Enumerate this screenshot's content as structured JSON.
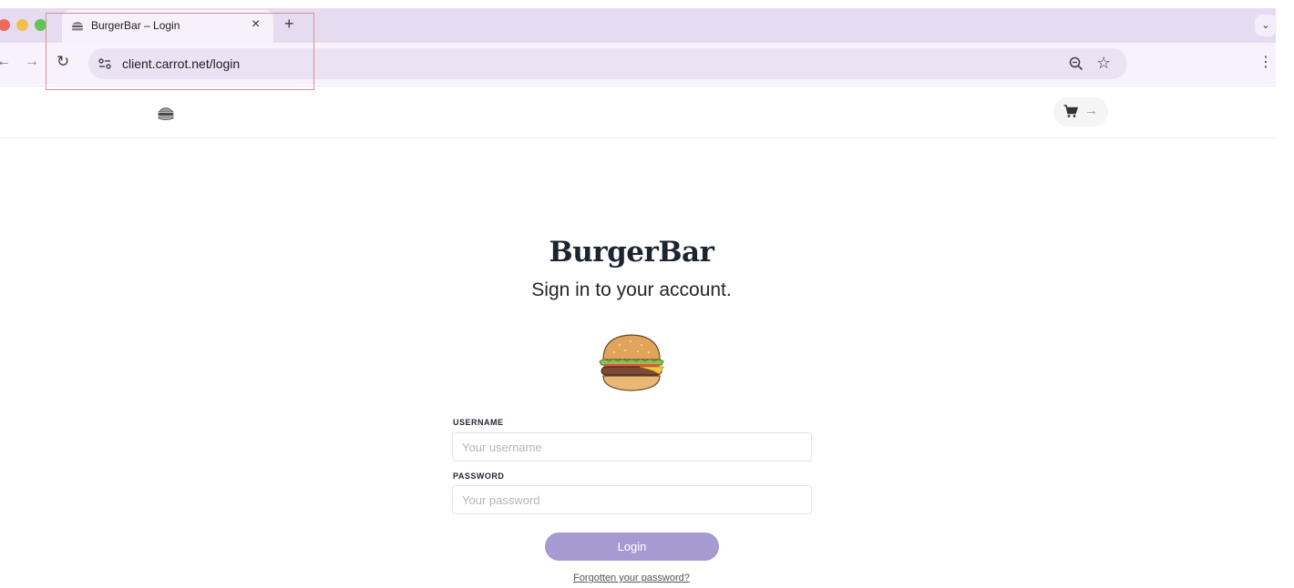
{
  "browser": {
    "tab": {
      "title": "BurgerBar – Login",
      "close_glyph": "×",
      "favicon": "burger-icon"
    },
    "new_tab_glyph": "+",
    "tab_menu_glyph": "⌄",
    "nav": {
      "back_glyph": "←",
      "forward_glyph": "→",
      "reload_glyph": "↻"
    },
    "url": "client.carrot.net/login",
    "bookmark_glyph": "☆",
    "menu_glyph": "⋮"
  },
  "header": {
    "logo": "burger-icon",
    "cart_arrow_glyph": "→"
  },
  "login": {
    "brand": "BurgerBar",
    "subtitle": "Sign in to your account.",
    "username_label": "USERNAME",
    "username_placeholder": "Your username",
    "password_label": "PASSWORD",
    "password_placeholder": "Your password",
    "button_label": "Login",
    "forgot_link": "Forgotten your password?"
  },
  "colors": {
    "tab_strip": "#e6dcf2",
    "toolbar": "#f7f2fc",
    "omnibox": "#ebe3f3",
    "login_button": "#a69ad0",
    "brand_text": "#1c2430",
    "annotation_box": "#d98c8c"
  }
}
